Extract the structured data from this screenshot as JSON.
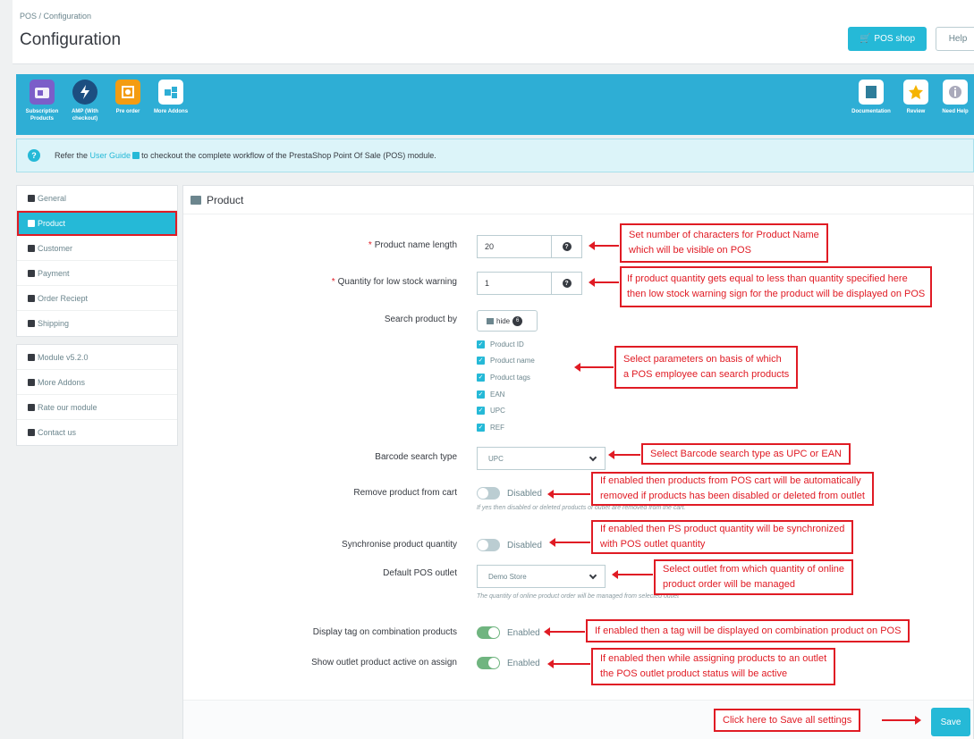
{
  "header": {
    "breadcrumb": "POS  /  Configuration",
    "title": "Configuration",
    "pos_shop_label": "POS shop",
    "help_label": "Help"
  },
  "banner": {
    "left_items": [
      {
        "label": "Subscription Products",
        "icon": "subscription-icon",
        "color": "#7b5ec9"
      },
      {
        "label": "AMP (With checkout)",
        "icon": "amp-bolt-icon",
        "color": "#1c4e80"
      },
      {
        "label": "Pre order",
        "icon": "preorder-icon",
        "color": "#f39c12"
      },
      {
        "label": "More Addons",
        "icon": "puzzle-icon",
        "color": "#ffffff"
      }
    ],
    "right_items": [
      {
        "label": "Documentation",
        "icon": "documentation-icon",
        "color": "#ffffff"
      },
      {
        "label": "Review",
        "icon": "star-icon",
        "color": "#ffffff"
      },
      {
        "label": "Need Help",
        "icon": "info-icon",
        "color": "#ffffff"
      }
    ]
  },
  "info": {
    "prefix": "Refer the ",
    "link": "User Guide",
    "suffix": " to checkout the complete workflow of the PrestaShop Point Of Sale (POS) module."
  },
  "sidebar": {
    "group1": [
      "General",
      "Product",
      "Customer",
      "Payment",
      "Order Reciept",
      "Shipping"
    ],
    "group2": [
      "Module v5.2.0",
      "More Addons",
      "Rate our module",
      "Contact us"
    ]
  },
  "panel": {
    "title": "Product",
    "product_name_length": {
      "label": "Product name length",
      "value": "20"
    },
    "low_stock": {
      "label": "Quantity for low stock warning",
      "value": "1"
    },
    "search_by": {
      "label": "Search product by",
      "hide_label": "hide",
      "hide_count": "6",
      "options": [
        "Product ID",
        "Product name",
        "Product tags",
        "EAN",
        "UPC",
        "REF"
      ]
    },
    "barcode": {
      "label": "Barcode search type",
      "value": "UPC"
    },
    "remove_product": {
      "label": "Remove product from cart",
      "state": "Disabled",
      "help": "If yes then disabled or deleted products of outlet are removed from the cart."
    },
    "sync_qty": {
      "label": "Synchronise product quantity",
      "state": "Disabled"
    },
    "default_outlet": {
      "label": "Default POS outlet",
      "value": "Demo Store",
      "help": "The quantity of online product order will be managed from selected outlet"
    },
    "display_tag": {
      "label": "Display tag on combination products",
      "state": "Enabled"
    },
    "show_outlet": {
      "label": "Show outlet product active on assign",
      "state": "Enabled"
    },
    "save_label": "Save"
  },
  "annotations": {
    "a1": [
      "Set number of characters for Product Name",
      "which will be visible on POS"
    ],
    "a2": [
      "If product quantity gets equal to less than quantity specified here",
      "then low stock warning sign for the product will be displayed on POS"
    ],
    "a3": [
      "Select parameters on basis of which",
      "a POS employee can search products"
    ],
    "a4": [
      "Select Barcode search type as UPC or EAN"
    ],
    "a5": [
      "If enabled then products from POS cart will be automatically",
      "removed if products has been disabled or deleted from outlet"
    ],
    "a6": [
      "If enabled then PS product quantity will be synchronized",
      "with POS outlet quantity"
    ],
    "a7": [
      "Select outlet from which quantity of online",
      "product order will be managed"
    ],
    "a8": [
      "If enabled then a tag will be displayed on combination product on POS"
    ],
    "a9": [
      "If enabled then while assigning products to an outlet",
      "the POS outlet product status will be active"
    ],
    "a10": [
      "Click here to Save all settings"
    ]
  },
  "colors": {
    "accent": "#25b9d7",
    "banner": "#2eaed5",
    "annotation": "#e01b24",
    "enabled": "#70b580"
  }
}
